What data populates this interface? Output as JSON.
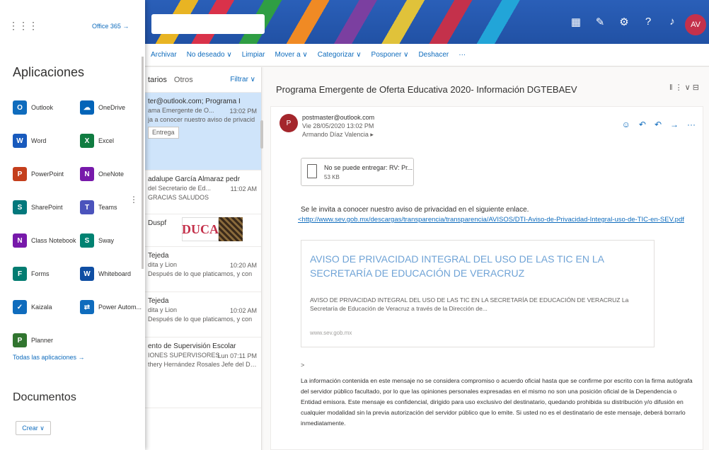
{
  "colors": {
    "brand": "#0f6cbd",
    "selected": "#cfe4fa",
    "sender_avatar": "#a4262c"
  },
  "topbar": {
    "avatar_initials": "AV",
    "icons": [
      "calendar-icon",
      "notes-icon",
      "settings-icon",
      "help-icon",
      "bell-icon"
    ]
  },
  "launcher": {
    "office365_link": "Office 365 →",
    "heading": "Aplicaciones",
    "apps": [
      {
        "label": "Outlook",
        "color": "#0f6cbd",
        "glyph": "O"
      },
      {
        "label": "OneDrive",
        "color": "#0364b8",
        "glyph": "☁"
      },
      {
        "label": "Word",
        "color": "#185abd",
        "glyph": "W"
      },
      {
        "label": "Excel",
        "color": "#107c41",
        "glyph": "X"
      },
      {
        "label": "PowerPoint",
        "color": "#c43e1c",
        "glyph": "P"
      },
      {
        "label": "OneNote",
        "color": "#7719aa",
        "glyph": "N"
      },
      {
        "label": "SharePoint",
        "color": "#03787c",
        "glyph": "S"
      },
      {
        "label": "Teams",
        "color": "#4b53bc",
        "glyph": "T"
      },
      {
        "label": "Class Notebook",
        "color": "#7719aa",
        "glyph": "N"
      },
      {
        "label": "Sway",
        "color": "#008272",
        "glyph": "S"
      },
      {
        "label": "Forms",
        "color": "#037c71",
        "glyph": "F"
      },
      {
        "label": "Whiteboard",
        "color": "#0f4ea3",
        "glyph": "W"
      },
      {
        "label": "Kaizala",
        "color": "#0f6cbd",
        "glyph": "✓"
      },
      {
        "label": "Power Autom...",
        "color": "#0f6cbd",
        "glyph": "⇄"
      },
      {
        "label": "Planner",
        "color": "#31752f",
        "glyph": "P"
      }
    ],
    "all_apps_link": "Todas las aplicaciones →",
    "documents_heading": "Documentos",
    "new_button": "Crear ∨"
  },
  "toolbar": {
    "items": [
      "Archivar",
      "No deseado ∨",
      "Limpiar",
      "Mover a ∨",
      "Categorizar ∨",
      "Posponer ∨",
      "Deshacer",
      "···"
    ]
  },
  "msglist": {
    "tab_focused": "tarios",
    "tab_other": "Otros",
    "filter": "Filtrar ∨",
    "messages": [
      {
        "sender": "ter@outlook.com; Programa I",
        "subject": "ama Emergente de O...",
        "time": "13:02 PM",
        "preview": "ja a conocer nuestro aviso de privacid",
        "chip": "Entrega"
      },
      {
        "sender": "adalupe García Almaraz pedr",
        "subject": "del Secretario de Ed...",
        "time": "11:02 AM",
        "preview": "GRACIAS SALUDOS",
        "chip": ""
      },
      {
        "sender": "Duspf",
        "subject": "",
        "time": "",
        "preview": "",
        "chip": ""
      },
      {
        "sender": "Tejeda",
        "subject": "dita y Lion",
        "time": "10:20 AM",
        "preview": "Después de lo que platicamos, y con",
        "chip": ""
      },
      {
        "sender": "Tejeda",
        "subject": "dita y Lion",
        "time": "10:02 AM",
        "preview": "Después de lo que platicamos, y con",
        "chip": ""
      },
      {
        "sender": "ento de Supervisión Escolar",
        "subject": "IONES SUPERVISORES",
        "time": "Lun 07:11 PM",
        "preview": "thery Hernández Rosales Jefe del Depa",
        "chip": ""
      }
    ],
    "duca_logo": "DUCA"
  },
  "reading": {
    "subject": "Programa Emergente de Oferta Educativa 2020- Información DGTEBAEV",
    "subject_actions": "‖ ⋮ ∨  ⊟",
    "sender_initial": "P",
    "from": "postmaster@outlook.com",
    "date": "Vie 28/05/2020 13:02 PM",
    "to": "Armando Díaz Valencia ▸",
    "attachment_name": "No se puede entregar: RV: Pr...",
    "attachment_size": "53 KB",
    "intro": "Se le invita a conocer nuestro aviso de privacidad en el siguiente enlace.",
    "link": "<http://www.sev.gob.mx/descargas/transparencia/transparencia/AVISOS/DTI-Aviso-de-Privacidad-Integral-uso-de-TIC-en-SEV.pdf",
    "preview_title": "AVISO DE PRIVACIDAD INTEGRAL DEL USO DE LAS TIC EN LA SECRETARÍA DE EDUCACIÓN DE VERACRUZ",
    "preview_desc": "AVISO DE PRIVACIDAD INTEGRAL DEL USO DE LAS TIC EN LA SECRETARÍA DE EDUCACIÓN DE VERACRUZ La Secretaría de Educación de Veracruz a través de la Dirección de...",
    "preview_domain": "www.sev.gob.mx",
    "gt": ">",
    "disclaimer": "La información contenida en este mensaje no se considera compromiso o acuerdo oficial hasta que se confirme por escrito con la firma autógrafa del servidor público facultado, por lo que las opiniones personales expresadas en el mismo no son una posición oficial de la Dependencia o Entidad emisora. Este mensaje es confidencial, dirigido para uso exclusivo del destinatario, quedando prohibida su distribución y/o difusión en cualquier modalidad sin la previa autorización del servidor público que lo emite. Si usted no es el destinatario de este mensaje, deberá borrarlo inmediatamente."
  }
}
